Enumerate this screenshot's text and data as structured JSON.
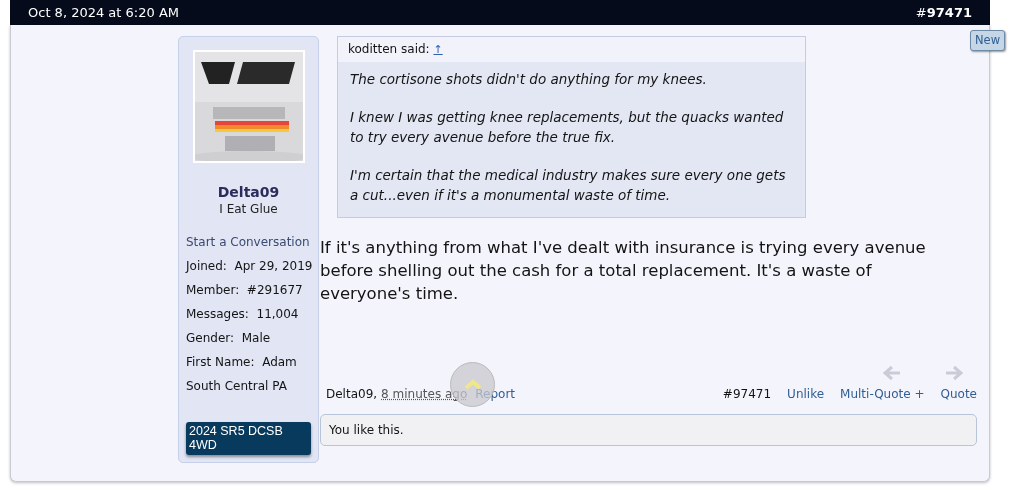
{
  "header": {
    "date": "Oct 8, 2024 at 6:20 AM",
    "post_number": "#**97471**"
  },
  "new_badge": "New",
  "user": {
    "name": "Delta09",
    "title": "I Eat Glue",
    "start_conversation": "Start a Conversation",
    "details": [
      "Joined:  Apr 29, 2019",
      "Member:  #291677",
      "Messages:  11,004",
      "Gender:  Male",
      "First Name:  Adam",
      "South Central PA"
    ],
    "vehicle": "2024 SR5 DCSB 4WD"
  },
  "quote": {
    "author": "koditten said:",
    "jump": "↑",
    "paragraphs": [
      "The cortisone shots didn't do anything for my knees.",
      "I knew I was getting knee replacements, but the quacks wanted to try every avenue before the true fix.",
      "I'm certain that the medical industry makes sure every one gets a cut...even if it's a monumental waste of time."
    ]
  },
  "message": "If it's anything from what I've dealt with insurance is trying every avenue before shelling out the cash for a total replacement. It's a waste of everyone's time.",
  "footer": {
    "author": "Delta09,",
    "time": "8 minutes ago",
    "report": "Report",
    "post_number": "#97471",
    "actions": [
      "Unlike",
      "Multi-Quote +",
      "Quote"
    ]
  },
  "likes": "You like this."
}
